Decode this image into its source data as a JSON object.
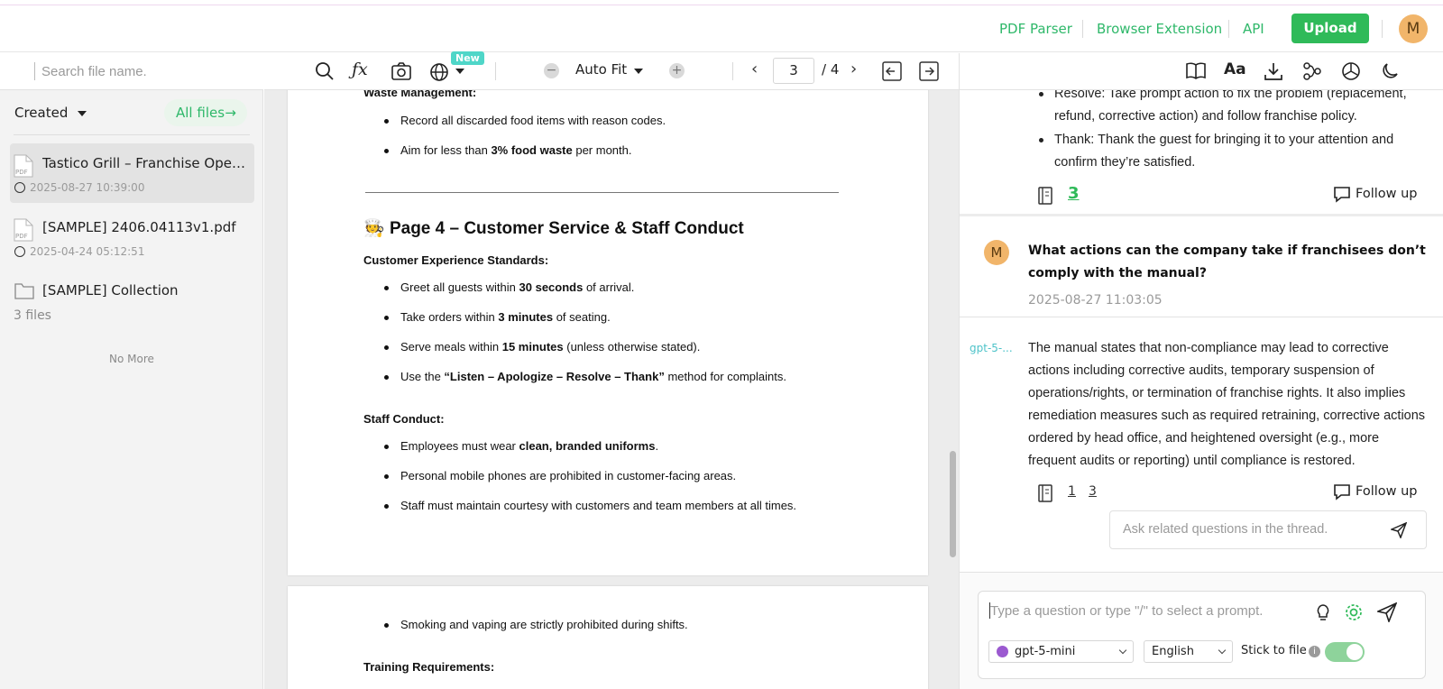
{
  "header": {
    "links": [
      "PDF Parser",
      "Browser Extension",
      "API"
    ],
    "upload_label": "Upload",
    "avatar_initial": "M"
  },
  "sidebar": {
    "search_placeholder": "Search file name.",
    "sort_label": "Created",
    "all_files_label": "All files",
    "files": [
      {
        "name": "Tastico Grill – Franchise Oper…",
        "date": "2025-08-27 10:39:00",
        "type": "pdf"
      },
      {
        "name": "[SAMPLE] 2406.04113v1.pdf",
        "date": "2025-04-24 05:12:51",
        "type": "pdf"
      }
    ],
    "collection": {
      "name": "[SAMPLE] Collection",
      "count": "3 files"
    },
    "no_more": "No More"
  },
  "pdf_toolbar": {
    "new_badge": "New",
    "zoom_label": "Auto Fit",
    "current_page": "3",
    "total_pages": "/ 4"
  },
  "pdf": {
    "page_a": {
      "top_section": "Waste Management:",
      "top_bullets": [
        {
          "pre": "Record all discarded food items with reason codes.",
          "bold": "",
          "post": ""
        },
        {
          "pre": "Aim for less than ",
          "bold": "3% food waste",
          "post": " per month."
        }
      ],
      "heading_emoji": "🧑‍🍳",
      "heading": "Page 4 – Customer Service & Staff Conduct",
      "section1": "Customer Experience Standards:",
      "section1_bullets": [
        {
          "pre": "Greet all guests within ",
          "bold": "30 seconds",
          "post": " of arrival."
        },
        {
          "pre": "Take orders within ",
          "bold": "3 minutes",
          "post": " of seating."
        },
        {
          "pre": "Serve meals within ",
          "bold": "15 minutes",
          "post": " (unless otherwise stated)."
        },
        {
          "pre": "Use the ",
          "bold": "“Listen – Apologize – Resolve – Thank”",
          "post": " method for complaints."
        }
      ],
      "section2": "Staff Conduct:",
      "section2_bullets": [
        {
          "pre": "Employees must wear ",
          "bold": "clean, branded uniforms",
          "post": "."
        },
        {
          "pre": "Personal mobile phones are prohibited in customer-facing areas.",
          "bold": "",
          "post": ""
        },
        {
          "pre": "Staff must maintain courtesy with customers and team members at all times.",
          "bold": "",
          "post": ""
        }
      ]
    },
    "page_b": {
      "bullet": "Smoking and vaping are strictly prohibited during shifts.",
      "section": "Training Requirements:"
    }
  },
  "chat": {
    "prev_answer_bullets": [
      {
        "line1": "Resolve: Take prompt action to fix the problem (replacement,",
        "line2": "refund, corrective action) and follow franchise policy."
      },
      {
        "line1": "Thank: Thank the guest for bringing it to your attention and",
        "line2": "confirm they’re satisfied."
      }
    ],
    "prev_ref": "3",
    "follow_up_label": "Follow up",
    "question": {
      "avatar": "M",
      "line1": "What actions can the company take if franchisees don’t",
      "line2": "comply with the manual?",
      "time": "2025-08-27 11:03:05"
    },
    "answer": {
      "model_tag": "gpt-5-...",
      "lines": [
        "The manual states that non-compliance may lead to corrective",
        "actions including corrective audits, temporary suspension of",
        "operations/rights, or termination of franchise rights. It also implies",
        "remediation measures such as required retraining, corrective actions",
        "ordered by head office, and heightened oversight (e.g., more",
        "frequent audits or reporting) until compliance is restored."
      ],
      "refs": [
        "1",
        "3"
      ]
    },
    "thread_placeholder": "Ask related questions in the thread."
  },
  "composer": {
    "placeholder": "Type a question or type \"/\" to select a prompt.",
    "model": "gpt-5-mini",
    "language": "English",
    "stick_label": "Stick to file",
    "stick_on": true
  },
  "colors": {
    "accent_green": "#2fba59",
    "link_green": "#2fb86a",
    "new_badge": "#4fd6c8",
    "avatar": "#f1b56a",
    "model_tag": "#4ec3c9"
  }
}
